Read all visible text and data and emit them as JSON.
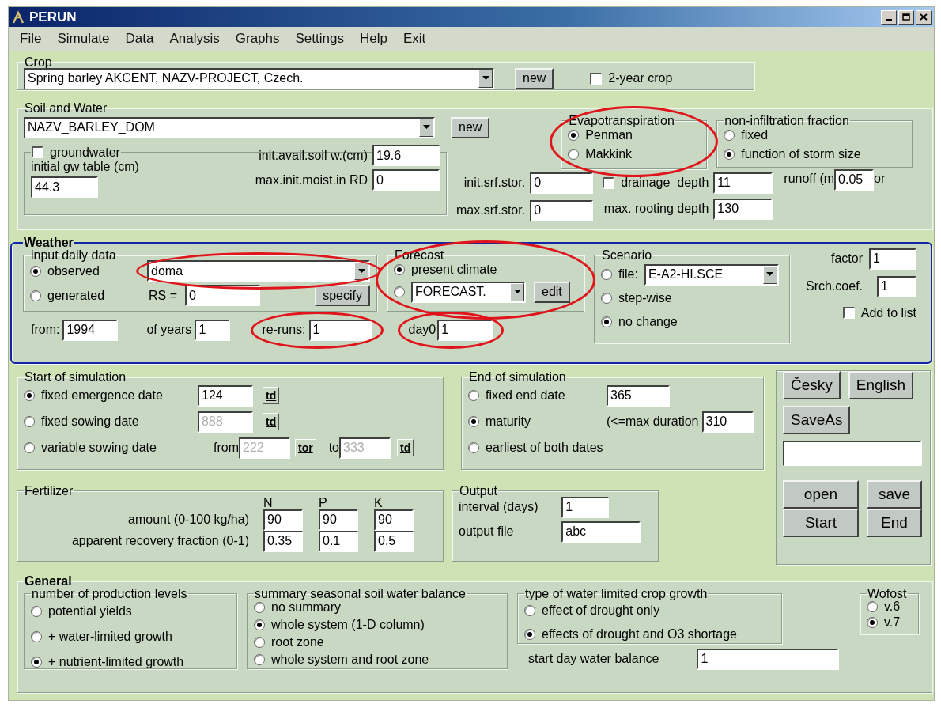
{
  "window": {
    "title": "PERUN"
  },
  "menu": [
    "File",
    "Simulate",
    "Data",
    "Analysis",
    "Graphs",
    "Settings",
    "Help",
    "Exit"
  ],
  "crop": {
    "label": "Crop",
    "selection": "Spring barley AKCENT, NAZV-PROJECT, Czech.",
    "button": "new",
    "two_year": {
      "label": "2-year crop",
      "checked": false
    }
  },
  "soil_water": {
    "label": "Soil and Water",
    "selection": "NAZV_BARLEY_DOM",
    "button": "new",
    "evapotranspiration": {
      "label": "Evapotranspiration",
      "circled": true,
      "options": [
        {
          "label": "Penman",
          "selected": true
        },
        {
          "label": "Makkink",
          "selected": false
        }
      ]
    },
    "non_infiltration": {
      "label": "non-infiltration fraction",
      "options": [
        {
          "label": "fixed",
          "selected": false
        },
        {
          "label": "function of storm size",
          "selected": true
        }
      ]
    },
    "groundwater": {
      "label": "groundwater",
      "checked": false
    },
    "gw_table": {
      "label": "initial gw table (cm)",
      "value": "44.3"
    },
    "soil_fields": [
      {
        "label": "init.avail.soil w.(cm)",
        "value": "19.6"
      },
      {
        "label": "max.init.moist.in RD",
        "value": "0"
      }
    ],
    "storage": [
      {
        "label": "init.srf.stor.",
        "value": "0"
      },
      {
        "label": "max.srf.stor.",
        "value": "0"
      }
    ],
    "drainage": {
      "label": "drainage  depth",
      "checked": false,
      "value": "11"
    },
    "rooting": {
      "label": "max. rooting depth",
      "value": "130"
    },
    "runoff": {
      "label": "runoff (m",
      "value": "0.05",
      "tail": "or"
    }
  },
  "weather": {
    "label": "Weather",
    "outlined": true,
    "input": {
      "label": "input daily data",
      "options": [
        {
          "label": "observed",
          "selected": true
        },
        {
          "label": "generated",
          "selected": false
        }
      ],
      "station": "doma",
      "station_circled": true,
      "rs_label": "RS =",
      "rs_value": "0",
      "button": "specify"
    },
    "forecast": {
      "label": "Forecast",
      "circled": true,
      "options": [
        {
          "label": "present climate",
          "selected": true
        },
        {
          "selected": false,
          "value": "FORECAST.",
          "button": "edit"
        }
      ]
    },
    "scenario": {
      "label": "Scenario",
      "options": [
        {
          "label": "file:",
          "selected": false,
          "value": "E-A2-HI.SCE"
        },
        {
          "label": "step-wise",
          "selected": false
        },
        {
          "label": "no change",
          "selected": true
        }
      ]
    },
    "from": {
      "label": "from:",
      "value": "1994"
    },
    "years": {
      "label": "of years",
      "value": "1"
    },
    "reruns": {
      "label": "re-runs:",
      "value": "1",
      "circled": true
    },
    "day0": {
      "label": "day0",
      "value": "1",
      "circled": true
    },
    "factor": {
      "label": "factor",
      "value": "1"
    },
    "srch": {
      "label": "Srch.coef.",
      "value": "1"
    },
    "add_to_list": {
      "label": "Add to list",
      "checked": false
    }
  },
  "start": {
    "label": "Start of simulation",
    "options": [
      {
        "kind": "date",
        "label": "fixed emergence date",
        "selected": true,
        "value": "124",
        "disabled": false,
        "button": "td"
      },
      {
        "kind": "date",
        "label": "fixed sowing date",
        "selected": false,
        "value": "888",
        "disabled": true,
        "button": "td"
      },
      {
        "kind": "range",
        "label": "variable sowing date",
        "selected": false,
        "from_label": "from",
        "value": "222",
        "disabled": true,
        "button": "tor",
        "to_label": "to",
        "to_value": "333",
        "to_button": "td"
      }
    ]
  },
  "end": {
    "label": "End of simulation",
    "options": [
      {
        "label": "fixed end date",
        "selected": false,
        "value": "365"
      },
      {
        "label": "maturity",
        "selected": true,
        "note": "(<=max duration",
        "value": "310"
      },
      {
        "label": "earliest of both dates",
        "selected": false
      }
    ]
  },
  "fertilizer": {
    "label": "Fertilizer",
    "columns": [
      "N",
      "P",
      "K"
    ],
    "rows": [
      {
        "label": "amount (0-100 kg/ha)",
        "values": [
          "90",
          "90",
          "90"
        ]
      },
      {
        "label": "apparent recovery fraction (0-1)",
        "values": [
          "0.35",
          "0.1",
          "0.5"
        ]
      }
    ]
  },
  "output": {
    "label": "Output",
    "fields": [
      {
        "label": "interval (days)",
        "value": "1"
      },
      {
        "label": "output file",
        "value": "abc"
      }
    ]
  },
  "actions": {
    "languages": [
      "Česky",
      "English"
    ],
    "save_as": "SaveAs",
    "buttons": [
      "open",
      "save",
      "Start",
      "End"
    ]
  },
  "general": {
    "label": "General",
    "groups": [
      {
        "label": "number of production levels",
        "options": [
          {
            "label": "potential yields",
            "selected": false
          },
          {
            "label": "+ water-limited growth",
            "selected": false
          },
          {
            "label": "+ nutrient-limited growth",
            "selected": true
          }
        ]
      },
      {
        "label": "summary seasonal soil water balance",
        "options": [
          {
            "label": "no summary",
            "selected": false
          },
          {
            "label": "whole system (1-D column)",
            "selected": true
          },
          {
            "label": "root zone",
            "selected": false
          },
          {
            "label": "whole system and root zone",
            "selected": false
          }
        ]
      },
      {
        "label": "type of water limited crop growth",
        "options": [
          {
            "label": "effect of drought only",
            "selected": false
          },
          {
            "label": "effects of drought and O3 shortage",
            "selected": true
          }
        ]
      },
      {
        "label": "Wofost",
        "options": [
          {
            "label": "v.6",
            "selected": false
          },
          {
            "label": "v.7",
            "selected": true
          }
        ]
      }
    ],
    "start_day": {
      "label": "start day water balance",
      "value": "1"
    }
  }
}
